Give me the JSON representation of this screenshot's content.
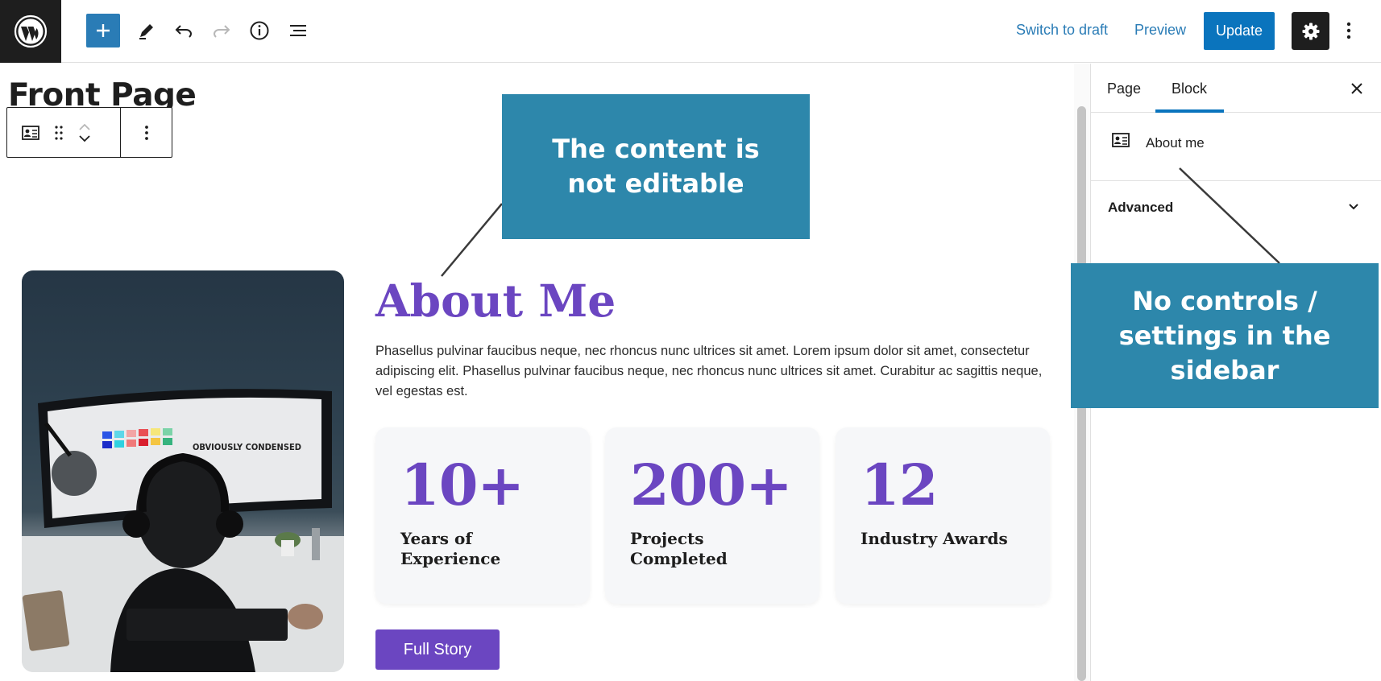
{
  "header": {
    "inserter_icon": "plus-icon",
    "tools_icon": "pencil-icon",
    "undo_icon": "undo-icon",
    "redo_icon": "redo-icon",
    "details_icon": "info-icon",
    "list_view_icon": "list-view-icon",
    "switch_to_draft": "Switch to draft",
    "preview": "Preview",
    "update": "Update",
    "settings_icon": "gear-icon",
    "more_icon": "more-vertical-icon",
    "accent_color": "#0a74bd"
  },
  "editor": {
    "page_title": "Front Page",
    "block_toolbar": {
      "block_icon": "about-block-icon",
      "drag_icon": "drag-handle-icon",
      "move_up_icon": "chevron-up-icon",
      "move_down_icon": "chevron-down-icon",
      "options_icon": "more-vertical-icon"
    },
    "about": {
      "heading": "About Me",
      "text": "Phasellus pulvinar faucibus neque, nec rhoncus nunc ultrices sit amet. Lorem ipsum dolor sit amet, consectetur adipiscing elit. Phasellus pulvinar faucibus neque, nec rhoncus nunc ultrices sit amet. Curabitur ac sagittis neque, vel egestas est.",
      "stats": [
        {
          "number": "10+",
          "label": "Years of Experience"
        },
        {
          "number": "200+",
          "label": "Projects Completed"
        },
        {
          "number": "12",
          "label": "Industry Awards"
        }
      ],
      "button": "Full Story",
      "photo_text": "OBVIOUSLY CONDENSED",
      "accent_color": "#6b46c1"
    }
  },
  "sidebar": {
    "tabs": [
      {
        "label": "Page",
        "active": false
      },
      {
        "label": "Block",
        "active": true
      }
    ],
    "close_icon": "close-icon",
    "block_card": {
      "icon": "about-block-icon",
      "title": "About me"
    },
    "advanced": {
      "label": "Advanced",
      "icon": "chevron-down-icon"
    }
  },
  "annotations": {
    "content_not_editable": "The content is not editable",
    "no_sidebar_controls": "No controls / settings in the sidebar",
    "color": "#2d87ab"
  }
}
